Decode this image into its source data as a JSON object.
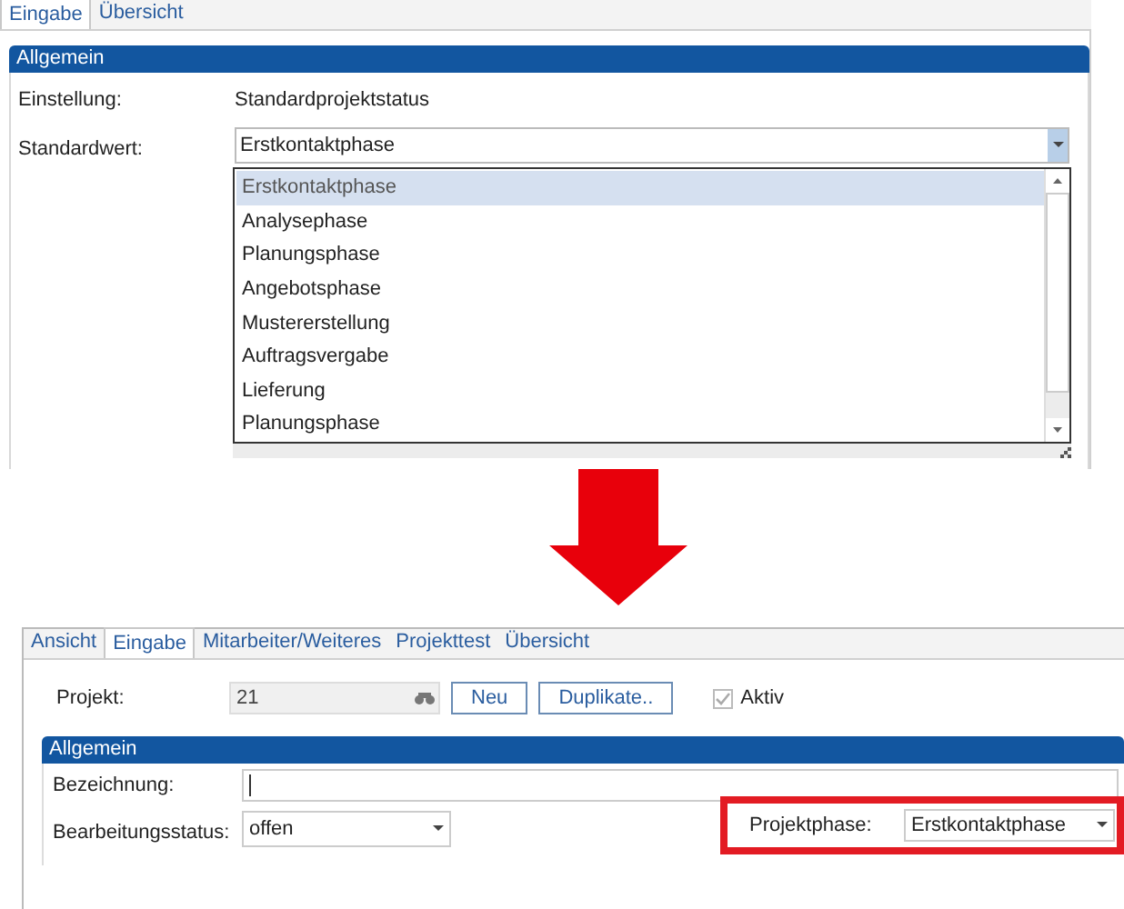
{
  "top": {
    "tabs": [
      {
        "label": "Eingabe",
        "selected": true
      },
      {
        "label": "Übersicht",
        "selected": false
      }
    ],
    "section": {
      "title": "Allgemein"
    },
    "setting": {
      "label": "Einstellung:",
      "value": "Standardprojektstatus"
    },
    "default": {
      "label": "Standardwert:",
      "value": "Erstkontaktphase"
    },
    "options": [
      {
        "label": "Erstkontaktphase",
        "selected": true
      },
      {
        "label": "Analysephase",
        "selected": false
      },
      {
        "label": "Planungsphase",
        "selected": false
      },
      {
        "label": "Angebotsphase",
        "selected": false
      },
      {
        "label": "Mustererstellung",
        "selected": false
      },
      {
        "label": "Auftragsvergabe",
        "selected": false
      },
      {
        "label": "Lieferung",
        "selected": false
      },
      {
        "label": "Planungsphase",
        "selected": false
      }
    ]
  },
  "bottom": {
    "tabs": [
      {
        "label": "Ansicht",
        "selected": false
      },
      {
        "label": "Eingabe",
        "selected": true
      },
      {
        "label": "Mitarbeiter/Weiteres",
        "selected": false
      },
      {
        "label": "Projekttest",
        "selected": false
      },
      {
        "label": "Übersicht",
        "selected": false
      }
    ],
    "project": {
      "label": "Projekt:",
      "value": "21",
      "buttons": [
        "Neu",
        "Duplikate.."
      ],
      "active": {
        "label": "Aktiv",
        "checked": true
      }
    },
    "section": {
      "title": "Allgemein"
    },
    "name_field": {
      "label": "Bezeichnung:"
    },
    "status_field": {
      "label": "Bearbeitungsstatus:",
      "value": "offen"
    },
    "phase_field": {
      "label": "Projektphase:",
      "value": "Erstkontaktphase",
      "highlighted": true
    }
  }
}
